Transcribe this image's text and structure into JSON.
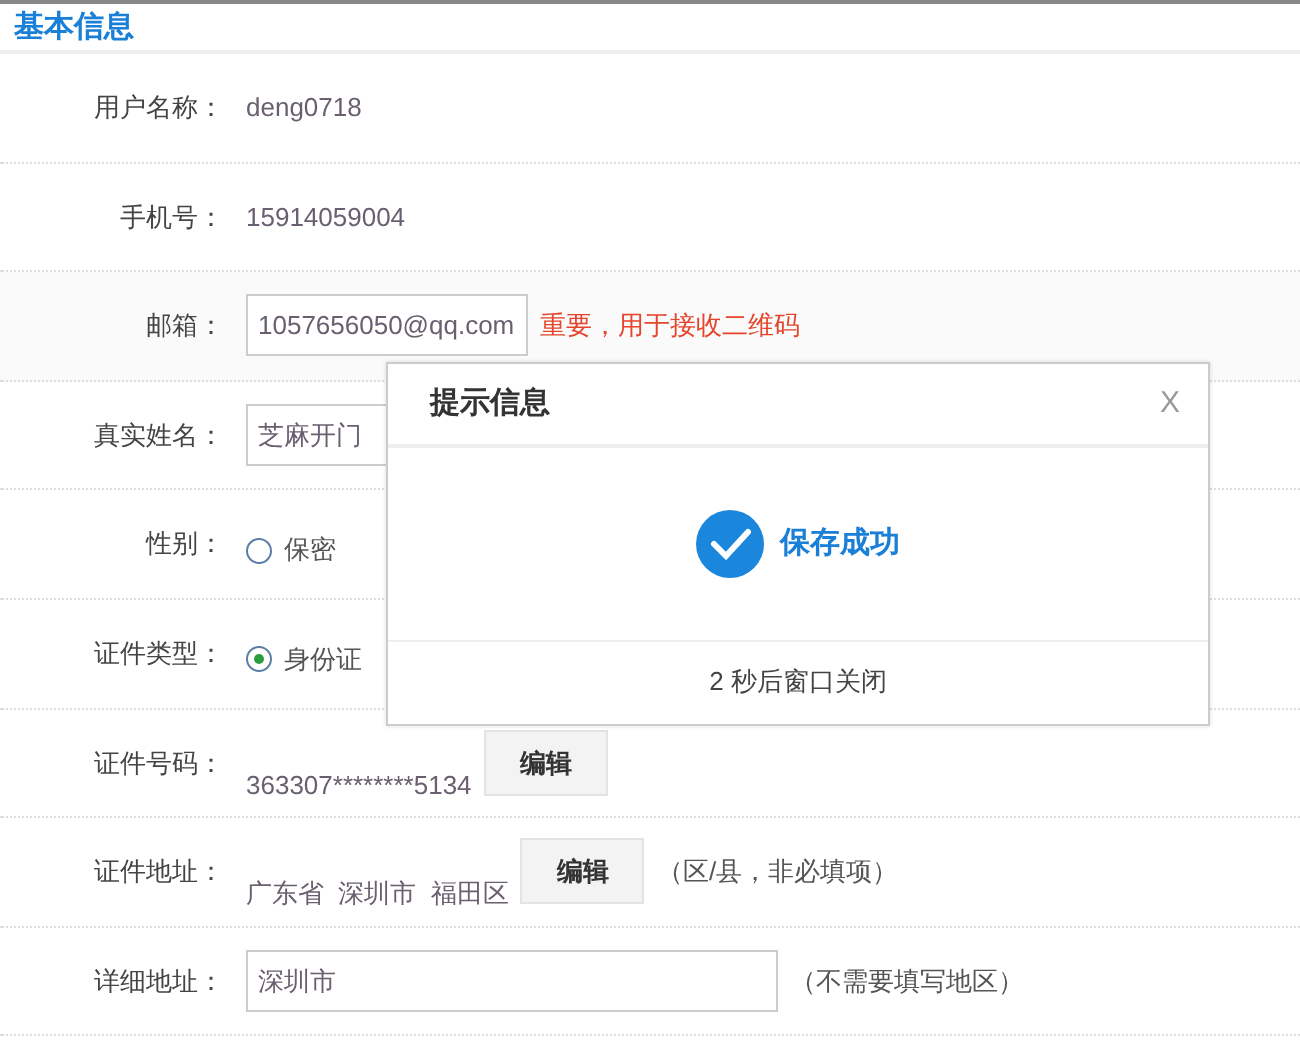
{
  "section_title": "基本信息",
  "rows": [
    {
      "kind": "text",
      "label": "用户名称：",
      "value": "deng0718"
    },
    {
      "kind": "text",
      "label": "手机号：",
      "value": "15914059004"
    },
    {
      "kind": "input",
      "label": "邮箱：",
      "value": "1057656050@qq.com",
      "note": "重要，用于接收二维码",
      "highlighted": true
    },
    {
      "kind": "input",
      "label": "真实姓名：",
      "value": "芝麻开门"
    },
    {
      "kind": "radio",
      "label": "性别：",
      "options": [
        {
          "label": "保密",
          "selected": false
        }
      ]
    },
    {
      "kind": "radio",
      "label": "证件类型：",
      "options": [
        {
          "label": "身份证",
          "selected": true
        }
      ]
    },
    {
      "kind": "edit",
      "label": "证件号码：",
      "value": "363307********5134",
      "button": "编辑"
    },
    {
      "kind": "edit",
      "label": "证件地址：",
      "value": "广东省  深圳市  福田区",
      "button": "编辑",
      "note": "（区/县，非必填项）"
    },
    {
      "kind": "input",
      "label": "详细地址：",
      "value": "深圳市",
      "note": "（不需要填写地区）",
      "wide": true
    }
  ],
  "dialog": {
    "title": "提示信息",
    "close": "X",
    "message": "保存成功",
    "footer": "2 秒后窗口关闭"
  }
}
